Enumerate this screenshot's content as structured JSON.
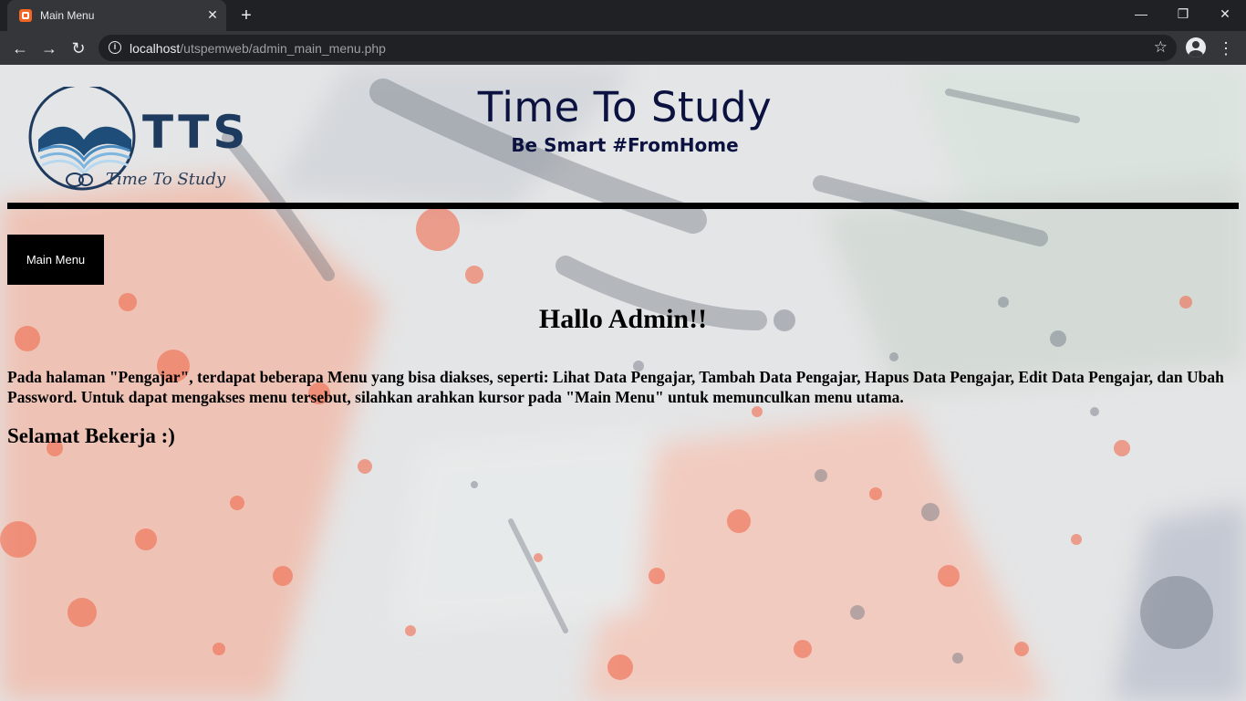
{
  "browser": {
    "tab_title": "Main Menu",
    "tab_close": "✕",
    "new_tab": "+",
    "url_host": "localhost",
    "url_path": "/utspemweb/admin_main_menu.php",
    "controls": {
      "minimize": "—",
      "maximize": "❐",
      "close": "✕"
    },
    "nav": {
      "back": "←",
      "forward": "→",
      "reload": "↻"
    },
    "star": "☆",
    "menu": "⋮",
    "colors": {
      "frame": "#202124",
      "toolbar": "#35363a",
      "text": "#e8eaed"
    }
  },
  "header": {
    "logo_text": "TTS",
    "logo_script": "Time To Study",
    "title": "Time To Study",
    "tagline": "Be Smart #FromHome",
    "colors": {
      "title": "#0b1240",
      "logo": "#1e3a5f"
    }
  },
  "nav_menu": {
    "label": "Main Menu"
  },
  "content": {
    "greeting": "Hallo Admin!!",
    "description": "Pada halaman \"Pengajar\", terdapat beberapa Menu yang bisa diakses, seperti: Lihat Data Pengajar, Tambah Data Pengajar, Hapus Data Pengajar, Edit Data Pengajar, dan Ubah Password. Untuk dapat mengakses menu tersebut, silahkan arahkan kursor pada \"Main Menu\" untuk memunculkan menu utama.",
    "closing": "Selamat Bekerja :)"
  }
}
